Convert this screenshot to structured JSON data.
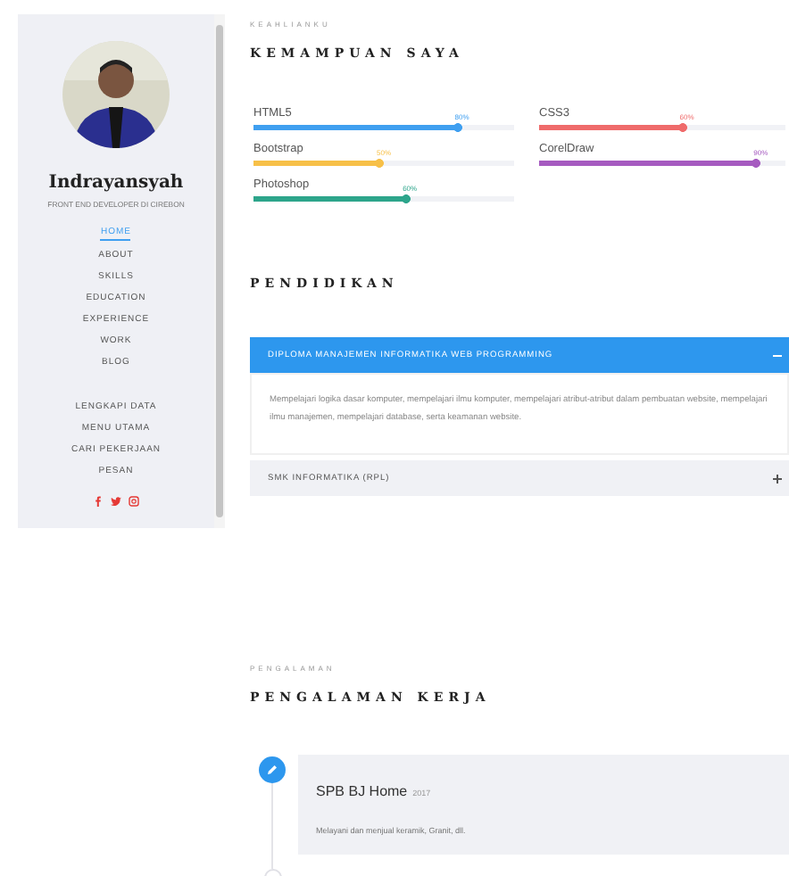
{
  "sidebar": {
    "avatar": {
      "kind": "picture"
    },
    "name": "Indrayansyah",
    "subtitle": "FRONT END DEVELOPER DI CIREBON",
    "nav": [
      {
        "label": "HOME",
        "selected": true
      },
      {
        "label": "ABOUT",
        "selected": false
      },
      {
        "label": "SKILLS",
        "selected": false
      },
      {
        "label": "EDUCATION",
        "selected": false
      },
      {
        "label": "EXPERIENCE",
        "selected": false
      },
      {
        "label": "WORK",
        "selected": false
      },
      {
        "label": "BLOG",
        "selected": false
      }
    ],
    "links": [
      "LENGKAPI DATA",
      "MENU UTAMA",
      "CARI PEKERJAAN",
      "PESAN"
    ]
  },
  "skills": {
    "eyebrow": "KEAHLIANKU",
    "title": "KEMAMPUAN SAYA",
    "items": [
      {
        "name": "HTML5",
        "reading": "80%",
        "level": 0.8,
        "color": "#3f9ff0"
      },
      {
        "name": "CSS3",
        "reading": "60%",
        "level": 0.6,
        "color": "#ef6b6b"
      },
      {
        "name": "Bootstrap",
        "reading": "50%",
        "level": 0.5,
        "color": "#f7c048"
      },
      {
        "name": "CorelDraw",
        "reading": "90%",
        "level": 0.9,
        "color": "#a65bc0"
      },
      {
        "name": "Photoshop",
        "reading": "60%",
        "level": 0.6,
        "color": "#2da58b"
      }
    ]
  },
  "education": {
    "title": "PENDIDIKAN",
    "items": [
      {
        "title": "DIPLOMA MANAJEMEN INFORMATIKA WEB PROGRAMMING",
        "expanded": true,
        "text": "Mempelajari logika dasar komputer, mempelajari ilmu komputer, mempelajari atribut-atribut dalam pembuatan website, mempelajari ilmu manajemen, mempelajari database, serta keamanan website."
      },
      {
        "title": "SMK INFORMATIKA (RPL)",
        "expanded": false
      }
    ]
  },
  "experience": {
    "eyebrow": "PENGALAMAN",
    "title": "PENGALAMAN KERJA",
    "items": [
      {
        "title": "SPB BJ Home",
        "year": "2017",
        "text": "Melayani dan menjual keramik, Granit, dll."
      }
    ]
  }
}
